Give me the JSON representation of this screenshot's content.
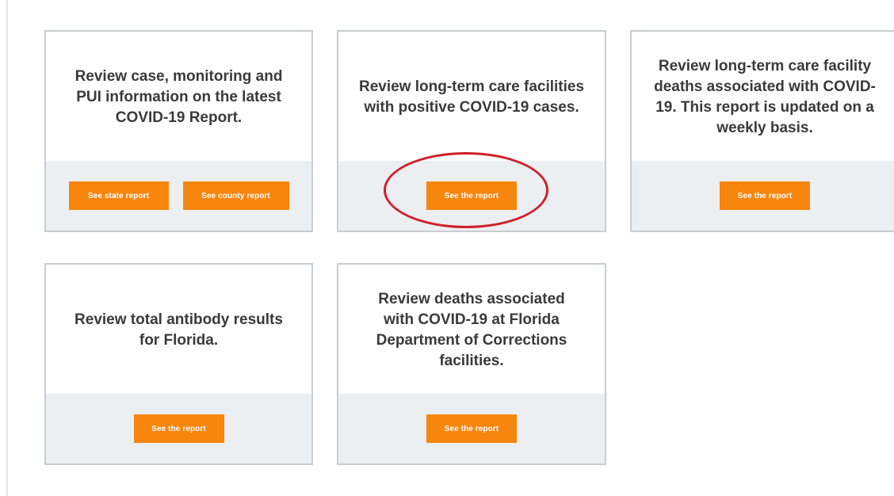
{
  "cards": [
    {
      "text": "Review case, monitoring and PUI information on the latest COVID-19 Report.",
      "buttons": [
        "See state report",
        "See county report"
      ]
    },
    {
      "text": "Review long-term care facilities with positive COVID-19 cases.",
      "buttons": [
        "See the report"
      ]
    },
    {
      "text": "Review long-term care facility deaths associated with COVID-19. This report is updated on a weekly basis.",
      "buttons": [
        "See the report"
      ]
    },
    {
      "text": "Review total antibody results for Florida.",
      "buttons": [
        "See the report"
      ]
    },
    {
      "text": "Review deaths associated with COVID-19 at Florida Department of Corrections facilities.",
      "buttons": [
        "See the report"
      ]
    }
  ],
  "colors": {
    "button": "#f7860f",
    "footer": "#eceff1",
    "card_border": "#c9cdd0",
    "highlight_ring": "#d0202a"
  }
}
